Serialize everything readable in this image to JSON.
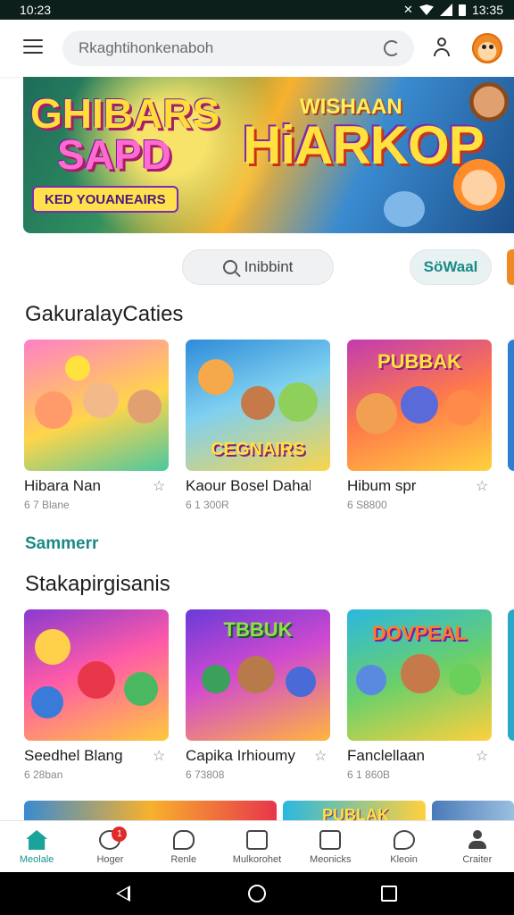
{
  "status_bar": {
    "time": "10:23",
    "right_time": "13:35"
  },
  "top_bar": {
    "search_placeholder": "Rkaghtihonkenaboh"
  },
  "banner": {
    "left_title_line1": "GHIBARS",
    "left_title_line2": "SAPD",
    "ribbon_text": "KED YOUANEAIRS",
    "small_title": "WISHAAN",
    "big_title": "HiARKOP"
  },
  "chips": [
    {
      "label": "Inibbint"
    },
    {
      "label": "SöWaal"
    }
  ],
  "sections": [
    {
      "title": "GakuralayCaties",
      "cards": [
        {
          "name": "Hibara Nan",
          "meta": "6 7 Blane",
          "logo": ""
        },
        {
          "name": "Kaour Bosel Dahal",
          "meta": "6 1 300R",
          "logo": "CEGNAIRS"
        },
        {
          "name": "Hibum spr",
          "meta": "6 S8800",
          "logo": "PUBBAK"
        }
      ]
    },
    {
      "title": "Stakapirgisanis",
      "cards": [
        {
          "name": "Seedhel Blang",
          "meta": "6 28ban",
          "logo": ""
        },
        {
          "name": "Capika Irhioumy",
          "meta": "6 73808",
          "logo": "TBBUK"
        },
        {
          "name": "Fanclellaan",
          "meta": "6 1 860B",
          "logo": "DOVPEAL"
        }
      ]
    }
  ],
  "see_more": "Sammerr",
  "peek_text": "PUBLAK",
  "bottom_nav": [
    {
      "label": "Meolale",
      "icon": "home-icon"
    },
    {
      "label": "Hoger",
      "icon": "search-notify-icon",
      "badge": "1"
    },
    {
      "label": "Renle",
      "icon": "chat-icon"
    },
    {
      "label": "Mulkorohet",
      "icon": "gallery-icon"
    },
    {
      "label": "Meonicks",
      "icon": "library-icon"
    },
    {
      "label": "Kleoin",
      "icon": "messages-icon"
    },
    {
      "label": "Craiter",
      "icon": "profile-icon"
    }
  ],
  "colors": {
    "accent": "#1aa39a",
    "badge": "#e02a2a"
  }
}
